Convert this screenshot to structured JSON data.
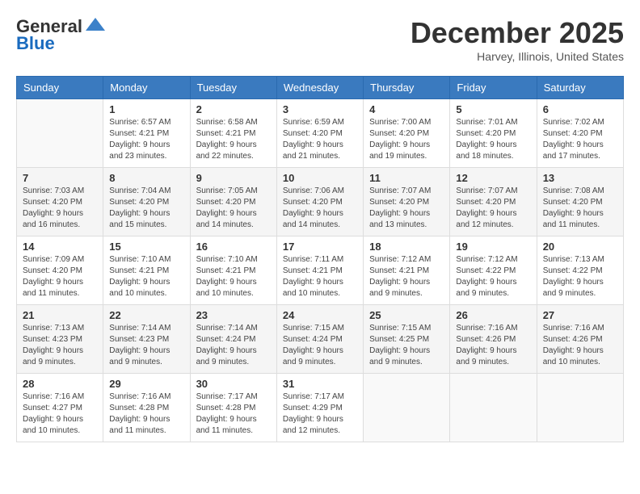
{
  "header": {
    "logo": {
      "line1": "General",
      "line2": "Blue",
      "icon": "▶"
    },
    "title": "December 2025",
    "location": "Harvey, Illinois, United States"
  },
  "columns": [
    "Sunday",
    "Monday",
    "Tuesday",
    "Wednesday",
    "Thursday",
    "Friday",
    "Saturday"
  ],
  "weeks": [
    [
      {
        "day": "",
        "info": ""
      },
      {
        "day": "1",
        "info": "Sunrise: 6:57 AM\nSunset: 4:21 PM\nDaylight: 9 hours\nand 23 minutes."
      },
      {
        "day": "2",
        "info": "Sunrise: 6:58 AM\nSunset: 4:21 PM\nDaylight: 9 hours\nand 22 minutes."
      },
      {
        "day": "3",
        "info": "Sunrise: 6:59 AM\nSunset: 4:20 PM\nDaylight: 9 hours\nand 21 minutes."
      },
      {
        "day": "4",
        "info": "Sunrise: 7:00 AM\nSunset: 4:20 PM\nDaylight: 9 hours\nand 19 minutes."
      },
      {
        "day": "5",
        "info": "Sunrise: 7:01 AM\nSunset: 4:20 PM\nDaylight: 9 hours\nand 18 minutes."
      },
      {
        "day": "6",
        "info": "Sunrise: 7:02 AM\nSunset: 4:20 PM\nDaylight: 9 hours\nand 17 minutes."
      }
    ],
    [
      {
        "day": "7",
        "info": "Sunrise: 7:03 AM\nSunset: 4:20 PM\nDaylight: 9 hours\nand 16 minutes."
      },
      {
        "day": "8",
        "info": "Sunrise: 7:04 AM\nSunset: 4:20 PM\nDaylight: 9 hours\nand 15 minutes."
      },
      {
        "day": "9",
        "info": "Sunrise: 7:05 AM\nSunset: 4:20 PM\nDaylight: 9 hours\nand 14 minutes."
      },
      {
        "day": "10",
        "info": "Sunrise: 7:06 AM\nSunset: 4:20 PM\nDaylight: 9 hours\nand 14 minutes."
      },
      {
        "day": "11",
        "info": "Sunrise: 7:07 AM\nSunset: 4:20 PM\nDaylight: 9 hours\nand 13 minutes."
      },
      {
        "day": "12",
        "info": "Sunrise: 7:07 AM\nSunset: 4:20 PM\nDaylight: 9 hours\nand 12 minutes."
      },
      {
        "day": "13",
        "info": "Sunrise: 7:08 AM\nSunset: 4:20 PM\nDaylight: 9 hours\nand 11 minutes."
      }
    ],
    [
      {
        "day": "14",
        "info": "Sunrise: 7:09 AM\nSunset: 4:20 PM\nDaylight: 9 hours\nand 11 minutes."
      },
      {
        "day": "15",
        "info": "Sunrise: 7:10 AM\nSunset: 4:21 PM\nDaylight: 9 hours\nand 10 minutes."
      },
      {
        "day": "16",
        "info": "Sunrise: 7:10 AM\nSunset: 4:21 PM\nDaylight: 9 hours\nand 10 minutes."
      },
      {
        "day": "17",
        "info": "Sunrise: 7:11 AM\nSunset: 4:21 PM\nDaylight: 9 hours\nand 10 minutes."
      },
      {
        "day": "18",
        "info": "Sunrise: 7:12 AM\nSunset: 4:21 PM\nDaylight: 9 hours\nand 9 minutes."
      },
      {
        "day": "19",
        "info": "Sunrise: 7:12 AM\nSunset: 4:22 PM\nDaylight: 9 hours\nand 9 minutes."
      },
      {
        "day": "20",
        "info": "Sunrise: 7:13 AM\nSunset: 4:22 PM\nDaylight: 9 hours\nand 9 minutes."
      }
    ],
    [
      {
        "day": "21",
        "info": "Sunrise: 7:13 AM\nSunset: 4:23 PM\nDaylight: 9 hours\nand 9 minutes."
      },
      {
        "day": "22",
        "info": "Sunrise: 7:14 AM\nSunset: 4:23 PM\nDaylight: 9 hours\nand 9 minutes."
      },
      {
        "day": "23",
        "info": "Sunrise: 7:14 AM\nSunset: 4:24 PM\nDaylight: 9 hours\nand 9 minutes."
      },
      {
        "day": "24",
        "info": "Sunrise: 7:15 AM\nSunset: 4:24 PM\nDaylight: 9 hours\nand 9 minutes."
      },
      {
        "day": "25",
        "info": "Sunrise: 7:15 AM\nSunset: 4:25 PM\nDaylight: 9 hours\nand 9 minutes."
      },
      {
        "day": "26",
        "info": "Sunrise: 7:16 AM\nSunset: 4:26 PM\nDaylight: 9 hours\nand 9 minutes."
      },
      {
        "day": "27",
        "info": "Sunrise: 7:16 AM\nSunset: 4:26 PM\nDaylight: 9 hours\nand 10 minutes."
      }
    ],
    [
      {
        "day": "28",
        "info": "Sunrise: 7:16 AM\nSunset: 4:27 PM\nDaylight: 9 hours\nand 10 minutes."
      },
      {
        "day": "29",
        "info": "Sunrise: 7:16 AM\nSunset: 4:28 PM\nDaylight: 9 hours\nand 11 minutes."
      },
      {
        "day": "30",
        "info": "Sunrise: 7:17 AM\nSunset: 4:28 PM\nDaylight: 9 hours\nand 11 minutes."
      },
      {
        "day": "31",
        "info": "Sunrise: 7:17 AM\nSunset: 4:29 PM\nDaylight: 9 hours\nand 12 minutes."
      },
      {
        "day": "",
        "info": ""
      },
      {
        "day": "",
        "info": ""
      },
      {
        "day": "",
        "info": ""
      }
    ]
  ]
}
